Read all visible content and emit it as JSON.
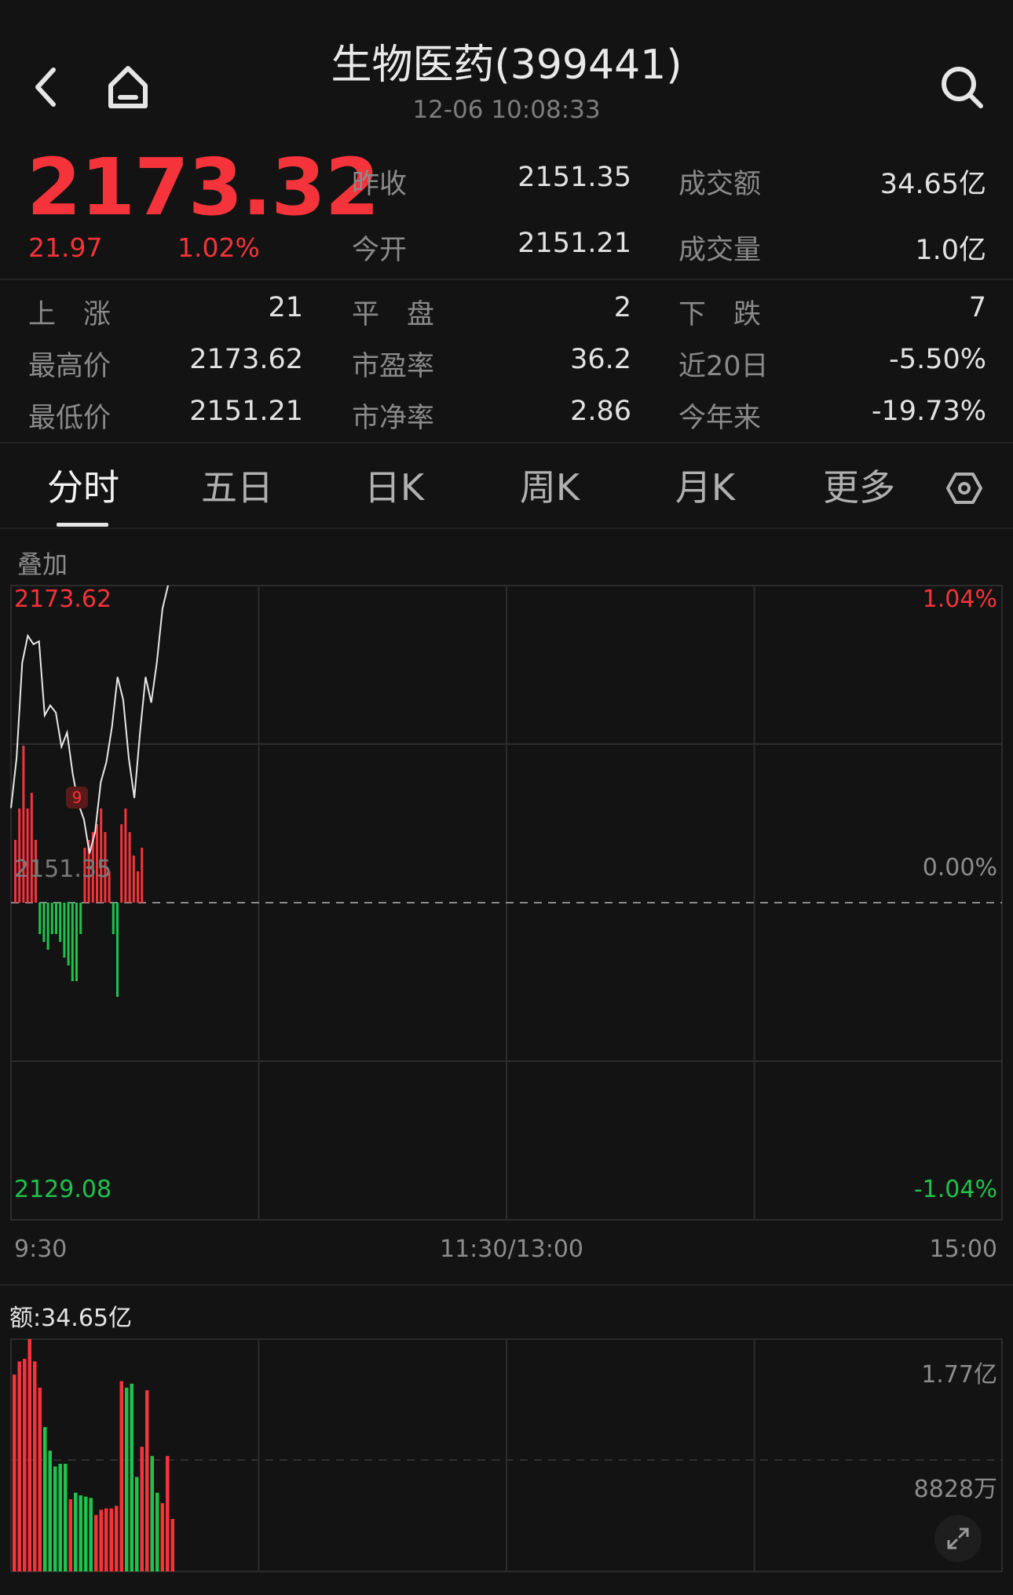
{
  "header": {
    "back_icon": "chevron-left-icon",
    "home_icon": "home-icon",
    "search_icon": "search-icon",
    "title": "生物医药(399441)",
    "time": "12-06 10:08:33"
  },
  "quote": {
    "price": "2173.32",
    "change": "21.97",
    "change_pct": "1.02%",
    "stats": [
      {
        "label": "昨收",
        "value": "2151.35"
      },
      {
        "label": "成交额",
        "value": "34.65亿"
      },
      {
        "label": "今开",
        "value": "2151.21"
      },
      {
        "label": "成交量",
        "value": "1.0亿"
      }
    ]
  },
  "breadth": [
    {
      "label": "上　涨",
      "value": "21"
    },
    {
      "label": "平　盘",
      "value": "2"
    },
    {
      "label": "下　跌",
      "value": "7"
    },
    {
      "label": "最高价",
      "value": "2173.62"
    },
    {
      "label": "市盈率",
      "value": "36.2"
    },
    {
      "label": "近20日",
      "value": "-5.50%"
    },
    {
      "label": "最低价",
      "value": "2151.21"
    },
    {
      "label": "市净率",
      "value": "2.86"
    },
    {
      "label": "今年来",
      "value": "-19.73%"
    }
  ],
  "tabs": [
    "分时",
    "五日",
    "日K",
    "周K",
    "月K",
    "更多"
  ],
  "settings_icon": "hexagon-settings-icon",
  "chart": {
    "overlay_label": "叠加",
    "top_price": "2173.62",
    "mid_price": "2151.35",
    "bottom_price": "2129.08",
    "top_pct": "1.04%",
    "mid_pct": "0.00%",
    "bottom_pct": "-1.04%",
    "marker": "9",
    "time_start": "9:30",
    "time_mid": "11:30/13:00",
    "time_end": "15:00",
    "amount_label": "额:34.65亿",
    "vol_top": "1.77亿",
    "vol_mid": "8828万",
    "expand_icon": "expand-arrows-icon"
  },
  "colors": {
    "up": "#f5333a",
    "down": "#1ec24c",
    "bg": "#131313",
    "grid": "#2c2c2c"
  },
  "chart_data": {
    "type": "line",
    "title": "",
    "x_range": [
      "9:30",
      "15:00"
    ],
    "ylim": [
      2129.08,
      2173.62
    ],
    "baseline": 2151.35,
    "price_line": [
      2158.0,
      2161.5,
      2168.2,
      2170.1,
      2169.5,
      2169.7,
      2164.5,
      2165.2,
      2164.7,
      2162.3,
      2163.3,
      2160.4,
      2158.3,
      2157.2,
      2154.8,
      2156.3,
      2159.8,
      2161.2,
      2163.7,
      2167.2,
      2165.6,
      2161.5,
      2158.7,
      2163.3,
      2167.2,
      2165.4,
      2168.2,
      2172.0,
      2173.62
    ],
    "breadth_bars": [
      8,
      12,
      20,
      12,
      14,
      8,
      -4,
      -5,
      -6,
      -4,
      -4,
      -5,
      -7,
      -8,
      -10,
      -10,
      -4,
      7,
      8,
      9,
      10,
      12,
      9,
      4,
      -4,
      -12,
      10,
      12,
      9,
      6,
      4,
      7
    ],
    "volume": {
      "ylabels": [
        "1.77亿",
        "8828万"
      ],
      "values": [
        1.5,
        1.6,
        1.62,
        1.77,
        1.6,
        1.4,
        1.1,
        0.92,
        0.8,
        0.82,
        0.82,
        0.55,
        0.6,
        0.58,
        0.57,
        0.56,
        0.43,
        0.47,
        0.48,
        0.48,
        0.5,
        1.45,
        1.4,
        1.43,
        0.72,
        0.95,
        1.38,
        0.88,
        0.6,
        0.52,
        0.88,
        0.4
      ],
      "up": [
        true,
        true,
        true,
        true,
        true,
        true,
        false,
        false,
        false,
        false,
        false,
        true,
        false,
        false,
        false,
        false,
        true,
        true,
        true,
        true,
        true,
        true,
        false,
        false,
        false,
        true,
        true,
        false,
        false,
        true,
        true,
        true
      ]
    }
  }
}
